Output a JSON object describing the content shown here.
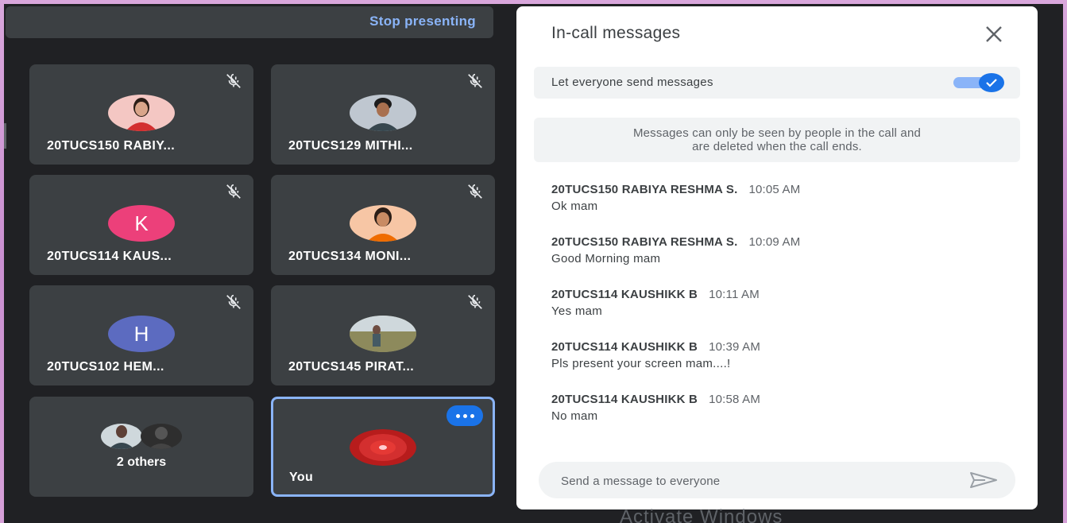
{
  "topbar": {
    "stop_presenting_label": "Stop presenting"
  },
  "tiles": [
    {
      "name": "20TUCS150 RABIY...",
      "avatar": "photo",
      "avatar_bg": "#f4c7c3",
      "mic": "mic-off-icon"
    },
    {
      "name": "20TUCS129 MITHI...",
      "avatar": "photo",
      "avatar_bg": "#bfc7d0",
      "mic": "mic-off-icon"
    },
    {
      "name": "20TUCS114 KAUS...",
      "avatar": "letter",
      "letter": "K",
      "avatar_bg": "#ec407a",
      "mic": "mic-off-icon"
    },
    {
      "name": "20TUCS134 MONI...",
      "avatar": "photo",
      "avatar_bg": "#f7c6a5",
      "mic": "mic-off-icon"
    },
    {
      "name": "20TUCS102 HEM...",
      "avatar": "letter",
      "letter": "H",
      "avatar_bg": "#5c6bc0",
      "mic": "mic-off-icon"
    },
    {
      "name": "20TUCS145 PIRAT...",
      "avatar": "photo",
      "avatar_bg": "#9e9e7a",
      "mic": "mic-off-icon"
    }
  ],
  "others_tile": {
    "label": "2 others"
  },
  "you_tile": {
    "label": "You",
    "avatar_color": "#c62828"
  },
  "panel": {
    "title": "In-call messages",
    "toggle_label": "Let everyone send messages",
    "toggle_on": true,
    "notice_line1": "Messages can only be seen by people in the call and",
    "notice_line2": "are deleted when the call ends.",
    "messages": [
      {
        "sender": "20TUCS150 RABIYA RESHMA S.",
        "time": "10:05 AM",
        "text": "Ok mam"
      },
      {
        "sender": "20TUCS150 RABIYA RESHMA S.",
        "time": "10:09 AM",
        "text": "Good Morning mam"
      },
      {
        "sender": "20TUCS114 KAUSHIKK B",
        "time": "10:11 AM",
        "text": "Yes mam"
      },
      {
        "sender": "20TUCS114 KAUSHIKK B",
        "time": "10:39 AM",
        "text": "Pls present your screen mam....!"
      },
      {
        "sender": "20TUCS114 KAUSHIKK B",
        "time": "10:58 AM",
        "text": "No mam"
      }
    ],
    "composer_placeholder": "Send a message to everyone"
  },
  "watermark": "Activate Windows",
  "colors": {
    "accent": "#1a73e8",
    "link": "#8ab4f8",
    "tile_bg": "#3c4043",
    "page_bg": "#202124"
  }
}
